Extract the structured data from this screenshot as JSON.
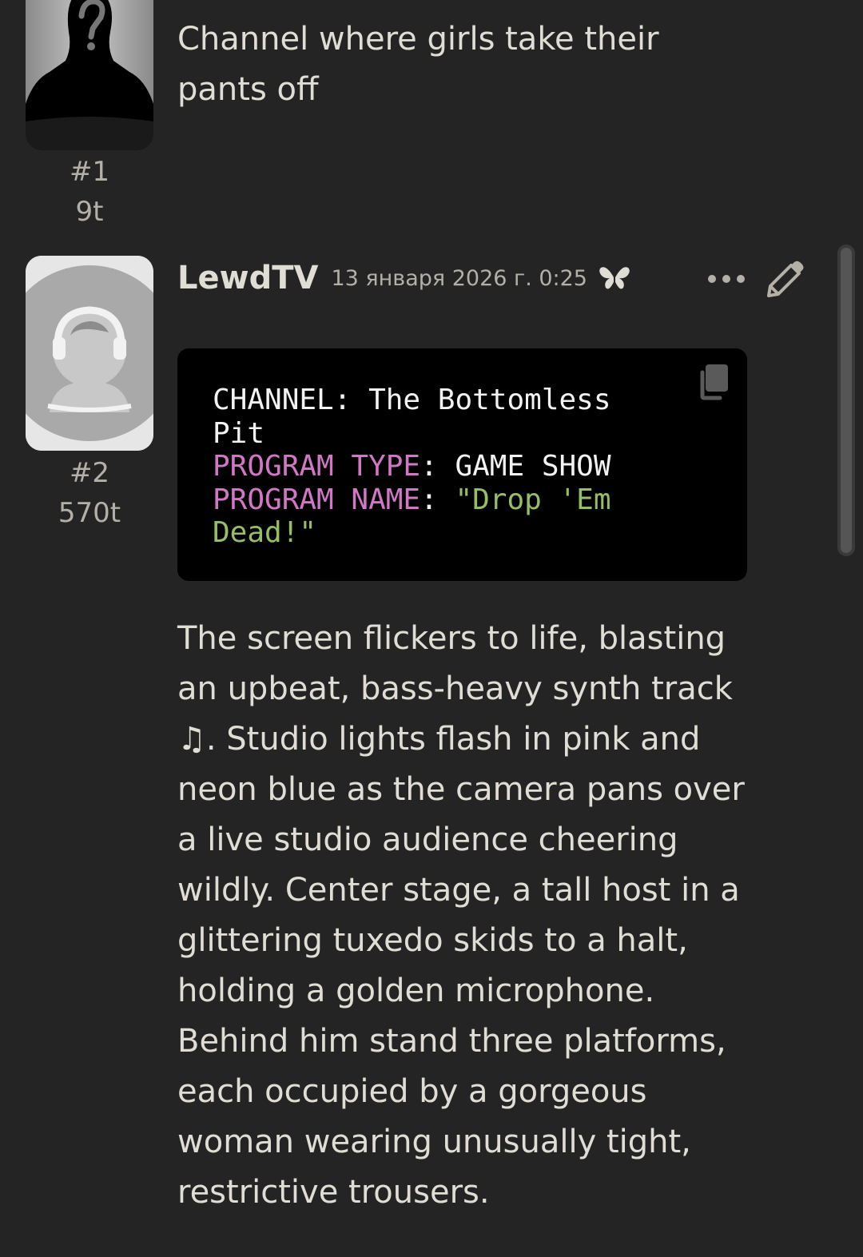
{
  "messages": [
    {
      "avatar_icon": "unknown-silhouette-avatar",
      "index": "#1",
      "tokens": "9t",
      "text": "Channel where girls take their pants off"
    },
    {
      "avatar_icon": "headphones-user-avatar",
      "index": "#2",
      "tokens": "570t",
      "character_name": "LewdTV",
      "timestamp": "13 января 2026 г. 0:25",
      "icons": {
        "swipe": "butterfly-icon",
        "more": "ellipsis-icon",
        "edit": "pencil-icon",
        "copy": "copy-icon"
      },
      "code_block": {
        "line1_key": "CHANNEL",
        "line1_value": "The Bottomless",
        "line1_value_cont": "Pit",
        "line2_key": "PROGRAM TYPE",
        "line2_value": "GAME SHOW",
        "line3_key": "PROGRAM NAME",
        "line3_value": "\"Drop 'Em",
        "line3_value_cont": "Dead!\""
      },
      "body": "The screen flickers to life, blasting an upbeat, bass-heavy synth track ♫. Studio lights flash in pink and neon blue as the camera pans over a live studio audience cheering wildly. Center stage, a tall host in a glittering tuxedo skids to a halt, holding a golden microphone. Behind him stand three platforms, each occupied by a gorgeous woman wearing unusually tight, restrictive trousers."
    }
  ],
  "colors": {
    "background": "#242424",
    "text": "#e0ddd5",
    "muted": "#b4b0a8",
    "code_bg": "#000000",
    "code_key": "#d277c6",
    "code_string": "#98be65"
  }
}
